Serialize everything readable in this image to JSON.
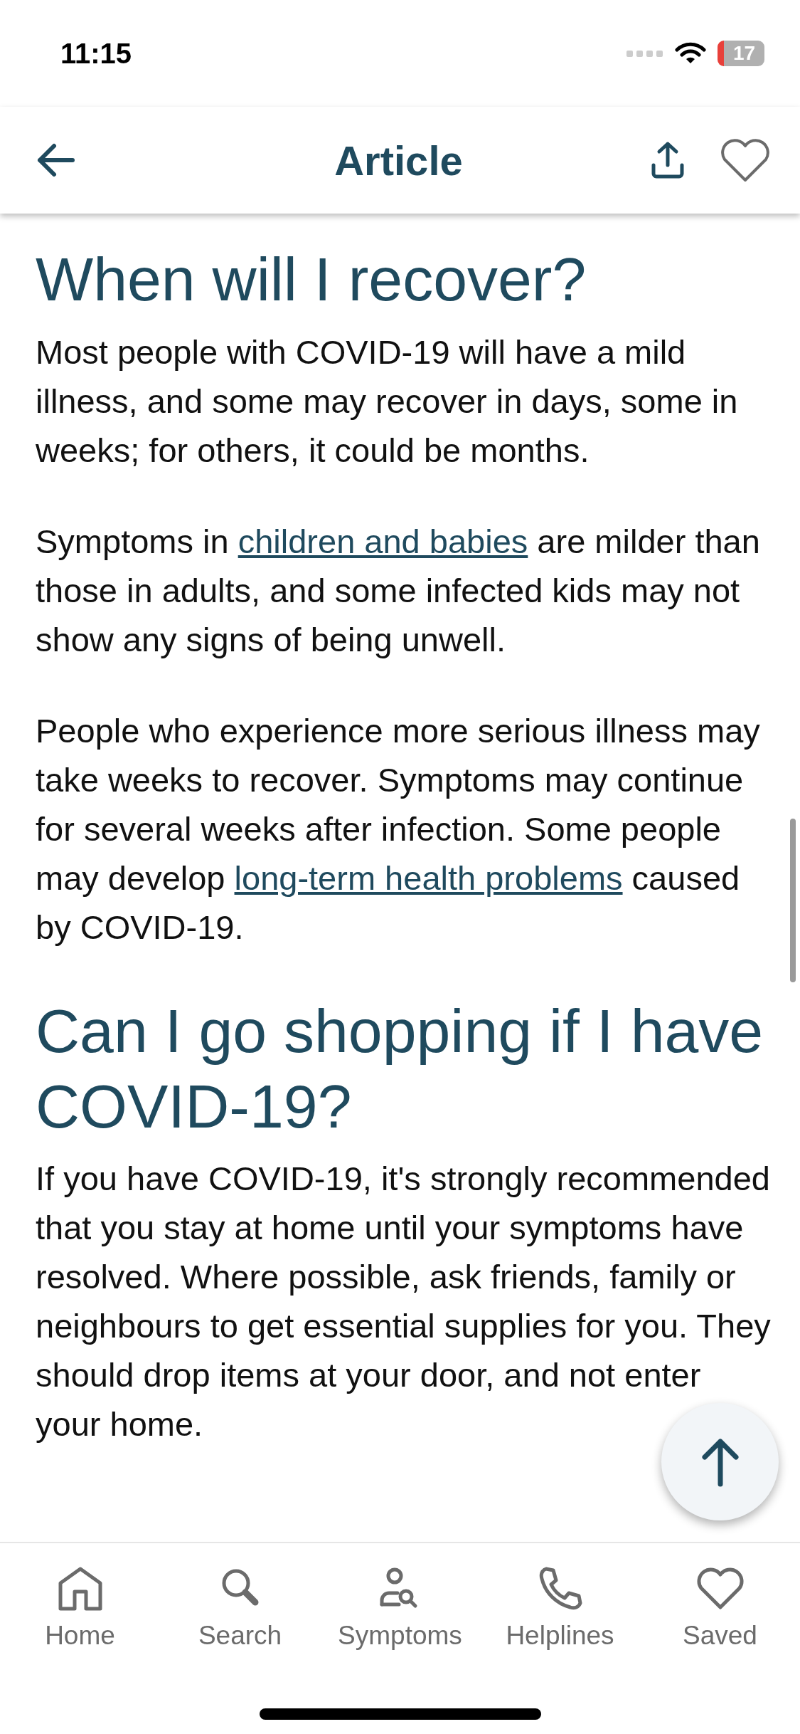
{
  "status_bar": {
    "time": "11:15",
    "battery": "17"
  },
  "header": {
    "title": "Article"
  },
  "article": [
    {
      "kind": "heading",
      "parts": [
        {
          "kind": "text",
          "text": "When will I recover?"
        }
      ]
    },
    {
      "kind": "paragraph",
      "parts": [
        {
          "kind": "text",
          "text": "Most people with COVID-19 will have a mild illness, and some may recover in days, some in weeks; for others, it could be months."
        }
      ]
    },
    {
      "kind": "paragraph",
      "parts": [
        {
          "kind": "text",
          "text": "Symptoms in "
        },
        {
          "kind": "link",
          "text": "children and babies"
        },
        {
          "kind": "text",
          "text": " are milder than those in adults, and some infected kids may not show any signs of being unwell."
        }
      ]
    },
    {
      "kind": "paragraph",
      "parts": [
        {
          "kind": "text",
          "text": "People who experience more serious illness may take weeks to recover. Symptoms may continue for several weeks after infection. Some people may develop "
        },
        {
          "kind": "link",
          "text": "long-term health problems"
        },
        {
          "kind": "text",
          "text": " caused by COVID-19."
        }
      ]
    },
    {
      "kind": "heading",
      "parts": [
        {
          "kind": "text",
          "text": "Can I go shopping if I have COVID-19?"
        }
      ]
    },
    {
      "kind": "paragraph",
      "parts": [
        {
          "kind": "text",
          "text": "If you have COVID-19, it's strongly recommended that you stay at home until your symptoms have resolved. Where possible, ask friends, family or neighbours to get essential supplies for you. They should drop items at your door, and not enter your home."
        }
      ]
    }
  ],
  "nav": [
    {
      "label": "Home",
      "kind": "home"
    },
    {
      "label": "Search",
      "kind": "search"
    },
    {
      "label": "Symptoms",
      "kind": "symptoms"
    },
    {
      "label": "Helplines",
      "kind": "phone"
    },
    {
      "label": "Saved",
      "kind": "heart"
    }
  ]
}
